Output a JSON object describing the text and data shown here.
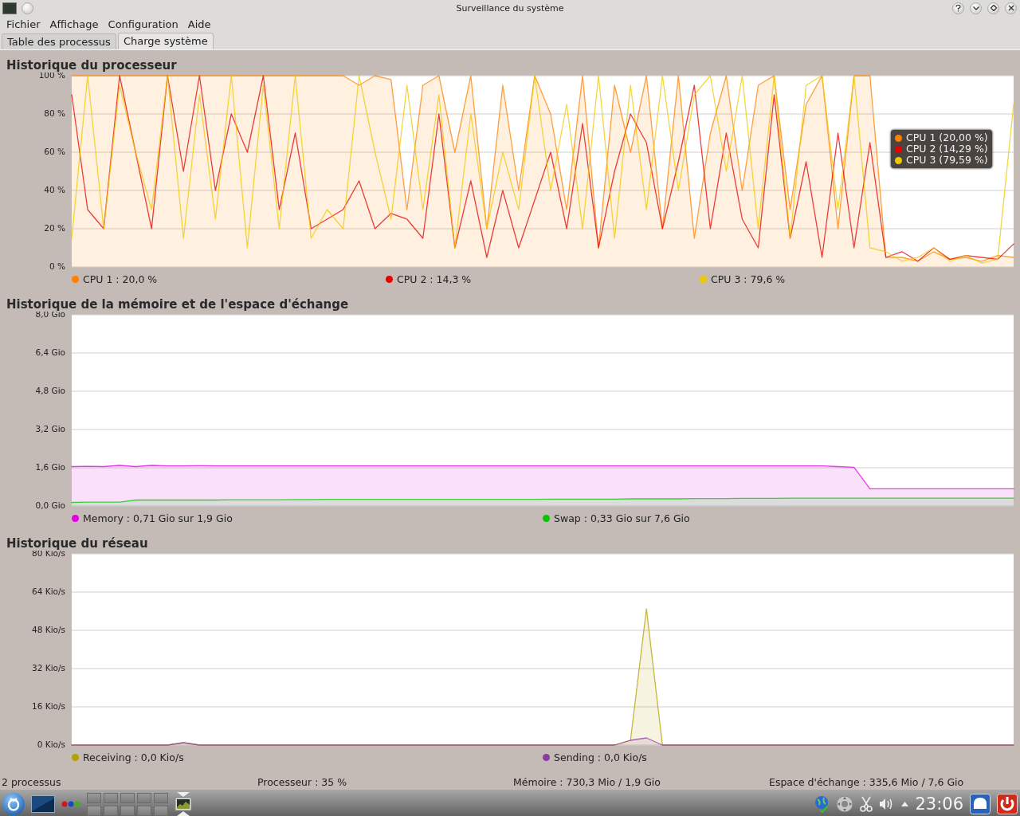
{
  "window": {
    "title": "Surveillance du système"
  },
  "menu": [
    "Fichier",
    "Affichage",
    "Configuration",
    "Aide"
  ],
  "tabs": [
    {
      "label": "Table des processus",
      "selected": false
    },
    {
      "label": "Charge système",
      "selected": true
    }
  ],
  "sections": [
    {
      "title": "Historique du processeur",
      "chart_data": {
        "type": "area",
        "grid": true,
        "ylim": [
          0,
          100
        ],
        "yticks": [
          {
            "value": 0,
            "label": "0 %"
          },
          {
            "value": 20,
            "label": "20 %"
          },
          {
            "value": 40,
            "label": "40 %"
          },
          {
            "value": 60,
            "label": "60 %"
          },
          {
            "value": 80,
            "label": "80 %"
          },
          {
            "value": 100,
            "label": "100 %"
          }
        ],
        "series": [
          {
            "name": "CPU 1",
            "color": "#ff8000",
            "values": [
              100,
              100,
              100,
              100,
              100,
              100,
              100,
              100,
              100,
              100,
              100,
              100,
              100,
              100,
              100,
              100,
              100,
              100,
              95,
              100,
              98,
              30,
              95,
              100,
              60,
              100,
              20,
              95,
              40,
              100,
              80,
              30,
              100,
              10,
              95,
              60,
              100,
              20,
              100,
              15,
              70,
              100,
              40,
              95,
              100,
              30,
              85,
              100,
              20,
              100,
              100,
              5,
              5,
              3,
              8,
              4,
              5,
              3,
              6,
              5
            ]
          },
          {
            "name": "CPU 2",
            "color": "#e60000",
            "type": "line",
            "values": [
              90,
              30,
              20,
              100,
              60,
              20,
              100,
              50,
              100,
              40,
              80,
              60,
              100,
              30,
              70,
              20,
              25,
              30,
              45,
              20,
              28,
              25,
              15,
              80,
              10,
              45,
              5,
              40,
              10,
              35,
              60,
              20,
              75,
              10,
              50,
              80,
              65,
              20,
              55,
              95,
              20,
              70,
              25,
              10,
              90,
              15,
              55,
              5,
              70,
              10,
              65,
              5,
              8,
              3,
              10,
              4,
              6,
              5,
              4,
              12
            ]
          },
          {
            "name": "CPU 3",
            "color": "#f0c800",
            "type": "line",
            "values": [
              15,
              100,
              20,
              95,
              60,
              30,
              100,
              15,
              90,
              25,
              100,
              10,
              95,
              20,
              100,
              15,
              30,
              20,
              100,
              60,
              25,
              95,
              30,
              90,
              10,
              80,
              20,
              60,
              30,
              100,
              40,
              85,
              20,
              100,
              15,
              95,
              30,
              100,
              40,
              90,
              100,
              50,
              100,
              20,
              100,
              15,
              95,
              100,
              30,
              100,
              10,
              8,
              3,
              5,
              10,
              3,
              6,
              2,
              4,
              85
            ]
          }
        ]
      },
      "legend": [
        ": 20,0 %",
        ": 14,3 %",
        ": 79,6 %"
      ],
      "tooltip": [
        "(20,00 %)",
        "(14,29 %)",
        "(79,59 %)"
      ]
    },
    {
      "title": "Historique de la mémoire et de l'espace d'échange",
      "chart_data": {
        "type": "area",
        "grid": true,
        "ylim": [
          0,
          8
        ],
        "yticks": [
          {
            "value": 0,
            "label": "0,0 Gio"
          },
          {
            "value": 1.6,
            "label": "1,6 Gio"
          },
          {
            "value": 3.2,
            "label": "3,2 Gio"
          },
          {
            "value": 4.8,
            "label": "4,8 Gio"
          },
          {
            "value": 6.4,
            "label": "6,4 Gio"
          },
          {
            "value": 8,
            "label": "8,0 Gio"
          }
        ],
        "series": [
          {
            "name": "Memory",
            "color": "#e000e0",
            "values": [
              1.65,
              1.66,
              1.65,
              1.7,
              1.65,
              1.7,
              1.68,
              1.68,
              1.69,
              1.68,
              1.68,
              1.68,
              1.68,
              1.68,
              1.68,
              1.68,
              1.68,
              1.68,
              1.68,
              1.68,
              1.68,
              1.68,
              1.68,
              1.68,
              1.68,
              1.68,
              1.68,
              1.68,
              1.68,
              1.68,
              1.68,
              1.68,
              1.68,
              1.68,
              1.68,
              1.68,
              1.68,
              1.68,
              1.68,
              1.68,
              1.68,
              1.68,
              1.68,
              1.68,
              1.68,
              1.68,
              1.68,
              1.68,
              1.65,
              1.62,
              0.72,
              0.72,
              0.72,
              0.72,
              0.72,
              0.72,
              0.72,
              0.72,
              0.72,
              0.72
            ]
          },
          {
            "name": "Swap",
            "color": "#00c800",
            "values": [
              0.15,
              0.16,
              0.16,
              0.16,
              0.25,
              0.25,
              0.25,
              0.25,
              0.25,
              0.25,
              0.26,
              0.26,
              0.26,
              0.26,
              0.27,
              0.27,
              0.28,
              0.28,
              0.28,
              0.28,
              0.28,
              0.28,
              0.28,
              0.28,
              0.28,
              0.28,
              0.28,
              0.28,
              0.28,
              0.28,
              0.29,
              0.29,
              0.29,
              0.29,
              0.29,
              0.3,
              0.3,
              0.3,
              0.3,
              0.31,
              0.31,
              0.31,
              0.32,
              0.32,
              0.32,
              0.33,
              0.33,
              0.33,
              0.33,
              0.33,
              0.33,
              0.33,
              0.33,
              0.33,
              0.33,
              0.33,
              0.33,
              0.33,
              0.33,
              0.33
            ]
          }
        ]
      },
      "legend": [
        ": 0,71 Gio sur 1,9 Gio",
        ": 0,33 Gio sur 7,6 Gio"
      ]
    },
    {
      "title": "Historique du réseau",
      "chart_data": {
        "type": "area",
        "grid": true,
        "ylim": [
          0,
          80
        ],
        "yticks": [
          {
            "value": 0,
            "label": "0 Kio/s"
          },
          {
            "value": 16,
            "label": "16 Kio/s"
          },
          {
            "value": 32,
            "label": "32 Kio/s"
          },
          {
            "value": 48,
            "label": "48 Kio/s"
          },
          {
            "value": 64,
            "label": "64 Kio/s"
          },
          {
            "value": 80,
            "label": "80 Kio/s"
          }
        ],
        "series": [
          {
            "name": "Receiving",
            "color": "#b4a000",
            "values": [
              0,
              0,
              0,
              0,
              0,
              0,
              0,
              1,
              0,
              0,
              0,
              0,
              0,
              0,
              0,
              0,
              0,
              0,
              0,
              0,
              0,
              0,
              0,
              0,
              0,
              0,
              0,
              0,
              0,
              0,
              0,
              0,
              0,
              0,
              0,
              2,
              57,
              0,
              0,
              0,
              0,
              0,
              0,
              0,
              0,
              0,
              0,
              0,
              0,
              0,
              0,
              0,
              0,
              0,
              0,
              0,
              0,
              0,
              0,
              0
            ]
          },
          {
            "name": "Sending",
            "color": "#8c3ca0",
            "values": [
              0,
              0,
              0,
              0,
              0,
              0,
              0,
              1,
              0,
              0,
              0,
              0,
              0,
              0,
              0,
              0,
              0,
              0,
              0,
              0,
              0,
              0,
              0,
              0,
              0,
              0,
              0,
              0,
              0,
              0,
              0,
              0,
              0,
              0,
              0,
              2,
              3,
              0,
              0,
              0,
              0,
              0,
              0,
              0,
              0,
              0,
              0,
              0,
              0,
              0,
              0,
              0,
              0,
              0,
              0,
              0,
              0,
              0,
              0,
              0
            ]
          }
        ]
      },
      "legend": [
        ": 0,0 Kio/s",
        ": 0,0 Kio/s"
      ]
    }
  ],
  "status_bar": [
    "2 processus",
    "Processeur : 35 %",
    "Mémoire : 730,3 Mio / 1,9 Gio",
    "Espace d'échange : 335,6 Mio / 7,6 Gio"
  ],
  "taskbar": {
    "clock": "23:06"
  }
}
